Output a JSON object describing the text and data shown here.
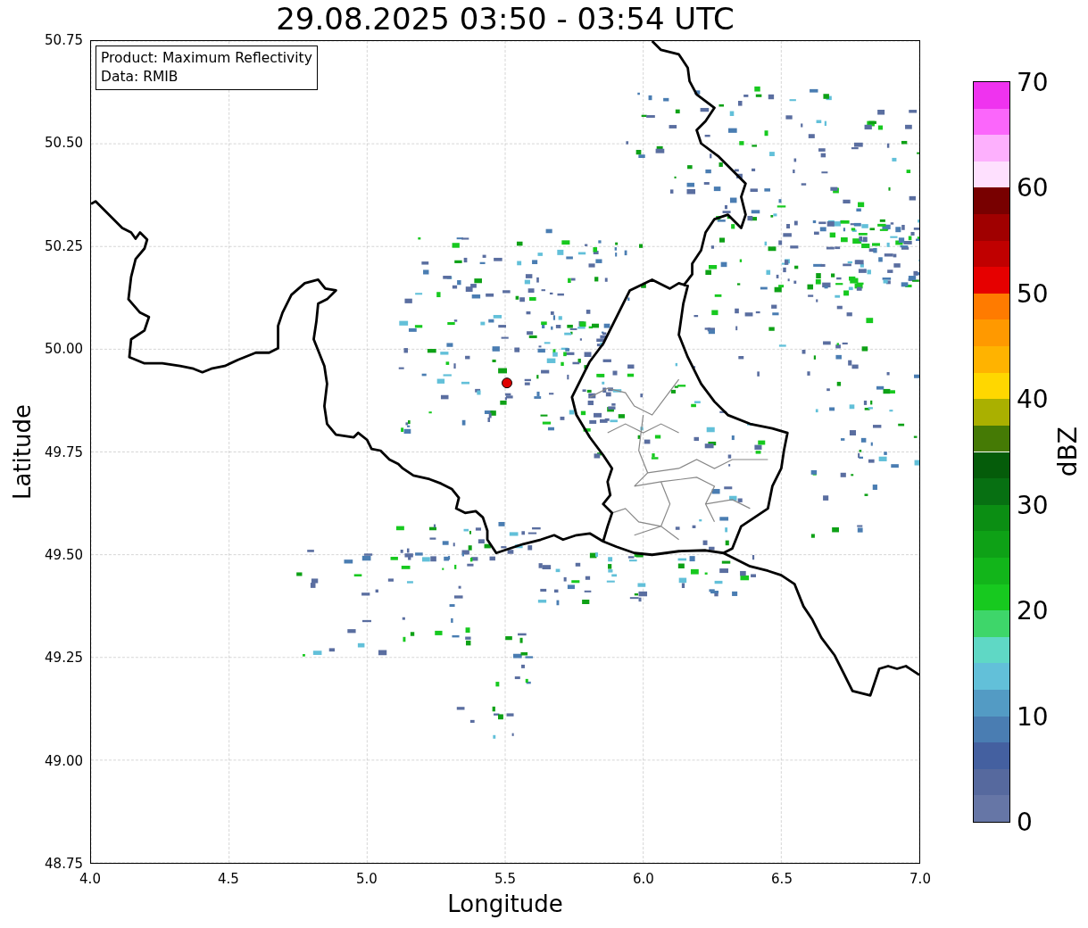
{
  "title": "29.08.2025 03:50 - 03:54 UTC",
  "map": {
    "xlabel": "Longitude",
    "ylabel": "Latitude",
    "xticks": [
      "4.0",
      "4.5",
      "5.0",
      "5.5",
      "6.0",
      "6.5",
      "7.0"
    ],
    "yticks": [
      "50.75",
      "50.50",
      "50.25",
      "50.00",
      "49.75",
      "49.50",
      "49.25",
      "49.00",
      "48.75"
    ],
    "legend": [
      "Product: Maximum Reflectivity",
      "Data: RMIB"
    ]
  },
  "colorbar": {
    "label": "dBZ",
    "ticks": [
      "70",
      "60",
      "50",
      "40",
      "30",
      "20",
      "10",
      "0"
    ],
    "segments": [
      {
        "color": "#6676a6"
      },
      {
        "color": "#56699e"
      },
      {
        "color": "#4460a0"
      },
      {
        "color": "#4a7db2"
      },
      {
        "color": "#539bc4"
      },
      {
        "color": "#62c0d9"
      },
      {
        "color": "#5fd8c5"
      },
      {
        "color": "#3ed66a"
      },
      {
        "color": "#17c91f"
      },
      {
        "color": "#12b51a"
      },
      {
        "color": "#0ea116"
      },
      {
        "color": "#0b8e13"
      },
      {
        "color": "#077012"
      },
      {
        "color": "#055c0a"
      },
      {
        "color": "#457a05"
      },
      {
        "color": "#aab000"
      },
      {
        "color": "#ffd700"
      },
      {
        "color": "#ffb300"
      },
      {
        "color": "#ff9900"
      },
      {
        "color": "#ff7b00"
      },
      {
        "color": "#e60000"
      },
      {
        "color": "#c00000"
      },
      {
        "color": "#a00000"
      },
      {
        "color": "#780000"
      },
      {
        "color": "#fee0fe"
      },
      {
        "color": "#fdb0fd"
      },
      {
        "color": "#fb66fb"
      },
      {
        "color": "#ef33ef"
      }
    ]
  }
}
